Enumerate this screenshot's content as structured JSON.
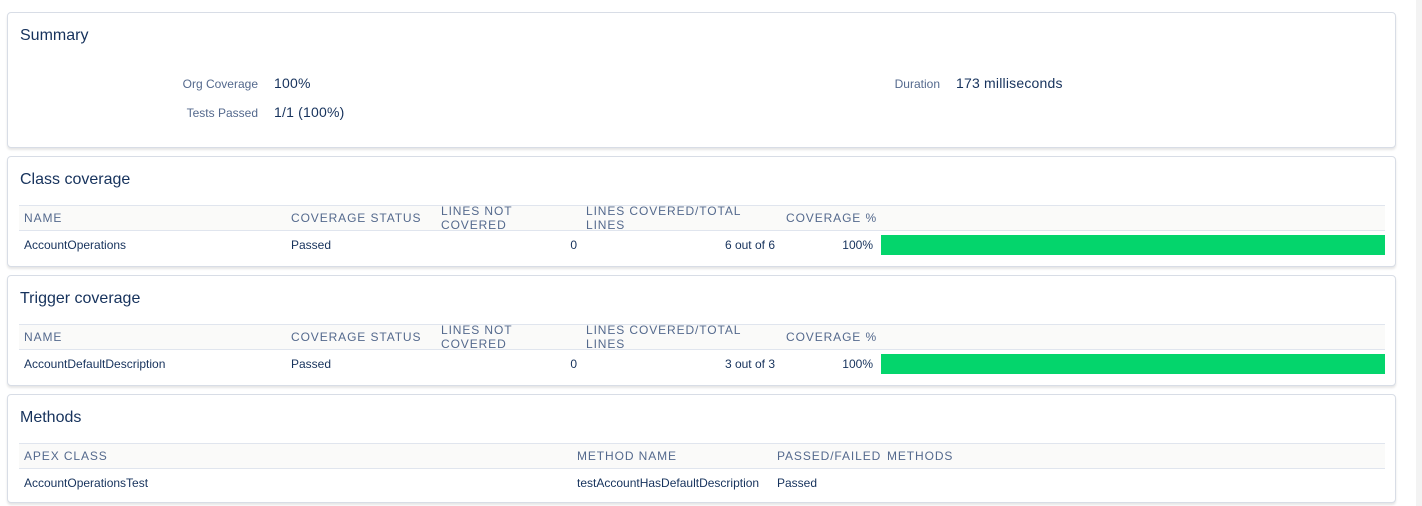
{
  "summary": {
    "title": "Summary",
    "org_coverage_label": "Org Coverage",
    "org_coverage_value": "100%",
    "tests_passed_label": "Tests Passed",
    "tests_passed_value": "1/1 (100%)",
    "duration_label": "Duration",
    "duration_value": "173 milliseconds"
  },
  "class_coverage": {
    "title": "Class coverage",
    "headers": [
      "NAME",
      "COVERAGE STATUS",
      "LINES NOT COVERED",
      "LINES COVERED/TOTAL LINES",
      "COVERAGE %"
    ],
    "rows": [
      {
        "name": "AccountOperations",
        "status": "Passed",
        "not_covered": "0",
        "covered_total": "6 out of 6",
        "coverage_pct": "100%",
        "coverage_fraction": 1.0
      }
    ]
  },
  "trigger_coverage": {
    "title": "Trigger coverage",
    "headers": [
      "NAME",
      "COVERAGE STATUS",
      "LINES NOT COVERED",
      "LINES COVERED/TOTAL LINES",
      "COVERAGE %"
    ],
    "rows": [
      {
        "name": "AccountDefaultDescription",
        "status": "Passed",
        "not_covered": "0",
        "covered_total": "3 out of 3",
        "coverage_pct": "100%",
        "coverage_fraction": 1.0
      }
    ]
  },
  "methods": {
    "title": "Methods",
    "headers": [
      "APEX CLASS",
      "METHOD NAME",
      "PASSED/FAILED",
      "METHODS"
    ],
    "rows": [
      {
        "apex_class": "AccountOperationsTest",
        "method_name": "testAccountHasDefaultDescription",
        "result": "Passed",
        "methods": ""
      }
    ]
  },
  "colors": {
    "coverage_bar": "#04d56c",
    "text": "#16325c",
    "muted": "#54698d"
  }
}
